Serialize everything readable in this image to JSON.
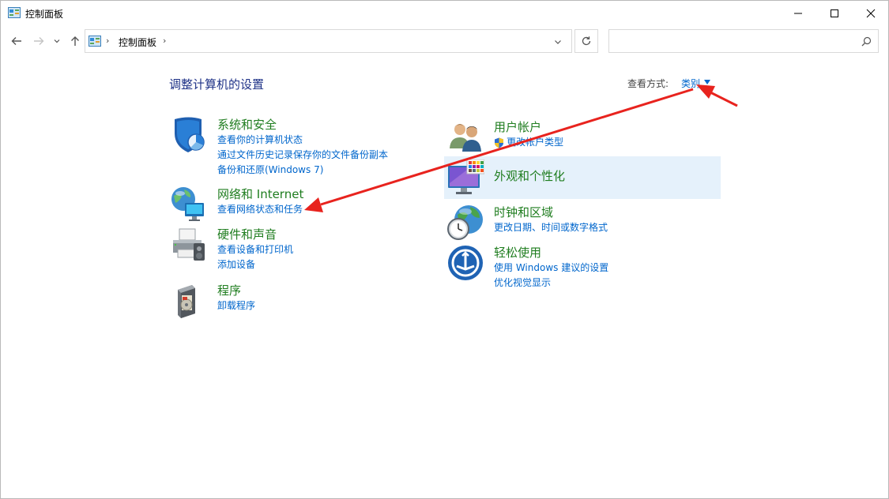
{
  "window": {
    "title": "控制面板"
  },
  "nav": {
    "breadcrumb": "控制面板",
    "search_placeholder": ""
  },
  "content": {
    "title": "调整计算机的设置",
    "view_by_label": "查看方式:",
    "view_by_value": "类别"
  },
  "categories_left": [
    {
      "title": "系统和安全",
      "links": [
        "查看你的计算机状态",
        "通过文件历史记录保存你的文件备份副本",
        "备份和还原(Windows 7)"
      ]
    },
    {
      "title": "网络和 Internet",
      "links": [
        "查看网络状态和任务"
      ]
    },
    {
      "title": "硬件和声音",
      "links": [
        "查看设备和打印机",
        "添加设备"
      ]
    },
    {
      "title": "程序",
      "links": [
        "卸载程序"
      ]
    }
  ],
  "categories_right": [
    {
      "title": "用户帐户",
      "links": [
        "更改帐户类型"
      ]
    },
    {
      "title": "外观和个性化",
      "links": []
    },
    {
      "title": "时钟和区域",
      "links": [
        "更改日期、时间或数字格式"
      ]
    },
    {
      "title": "轻松使用",
      "links": [
        "使用 Windows 建议的设置",
        "优化视觉显示"
      ]
    }
  ],
  "colors": {
    "link": "#0066cc",
    "category_title": "#1f7d1f",
    "page_title": "#1e3287",
    "highlight": "#e5f1fb",
    "annotation_arrow": "#e8231e"
  },
  "icons": {
    "app": "control-panel-icon",
    "system_security": "shield-icon",
    "network": "globe-network-icon",
    "hardware": "printer-icon",
    "programs": "programs-icon",
    "user_accounts": "users-icon",
    "appearance": "monitor-palette-icon",
    "clock_region": "clock-globe-icon",
    "ease_of_access": "ease-access-icon"
  }
}
